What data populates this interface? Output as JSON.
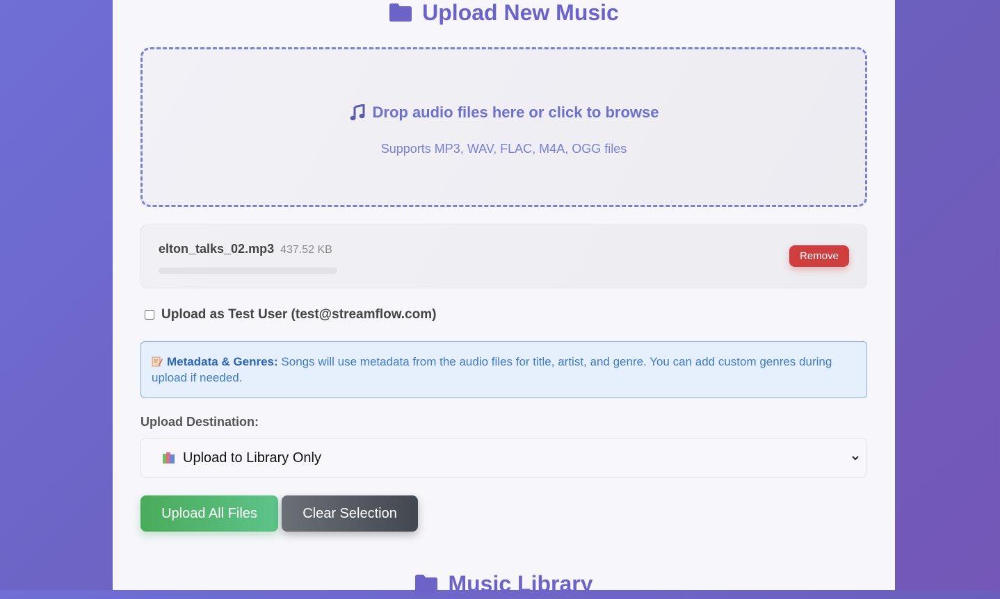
{
  "upload_section": {
    "title": "Upload New Music",
    "title_icon": "folder-icon"
  },
  "dropzone": {
    "icon": "music-note-icon",
    "main_text": "Drop audio files here or click to browse",
    "sub_text": "Supports MP3, WAV, FLAC, M4A, OGG files"
  },
  "selected_file": {
    "name": "elton_talks_02.mp3",
    "size": "437.52 KB",
    "progress": 0,
    "remove_label": "Remove"
  },
  "test_user": {
    "checked": false,
    "label": "Upload as Test User (test@streamflow.com)"
  },
  "info": {
    "icon": "memo-icon",
    "title": "Metadata & Genres:",
    "text": " Songs will use metadata from the audio files for title, artist, and genre. You can add custom genres during upload if needed."
  },
  "destination": {
    "label": "Upload Destination:",
    "icon": "books-icon",
    "selected": "Upload to Library Only"
  },
  "actions": {
    "upload_label": "Upload All Files",
    "clear_label": "Clear Selection"
  },
  "library_section": {
    "title": "Music Library",
    "title_icon": "folder-icon"
  },
  "colors": {
    "accent": "#6c63c8",
    "danger": "#cf3f3f",
    "success": "#49ab5a",
    "info_text": "#3e7bc9"
  }
}
